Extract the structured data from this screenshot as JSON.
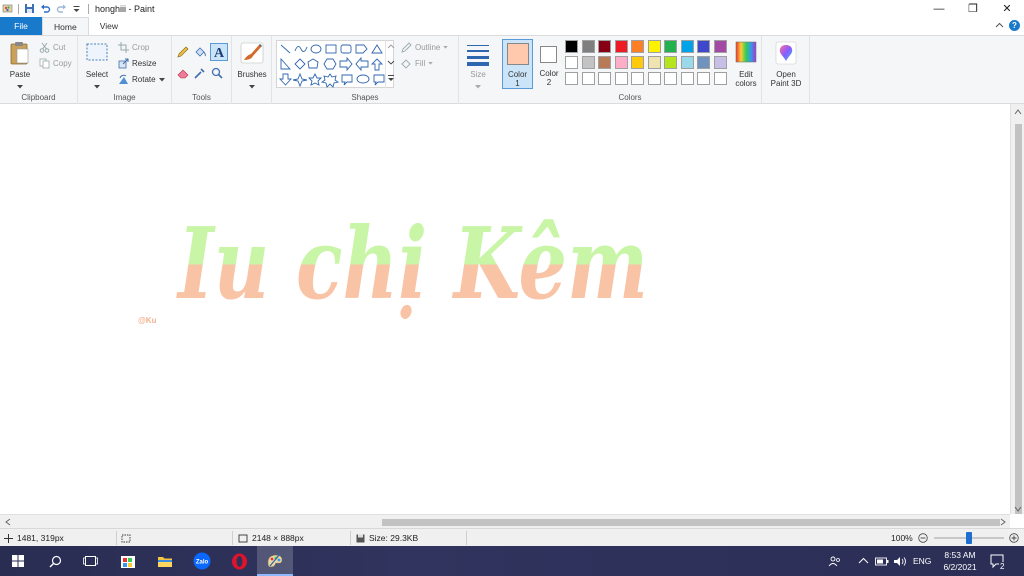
{
  "window": {
    "title": "honghiii - Paint",
    "minimize": "—",
    "restore": "❐",
    "close": "✕"
  },
  "tabs": [
    {
      "label": "File"
    },
    {
      "label": "Home"
    },
    {
      "label": "View"
    }
  ],
  "ribbon": {
    "clipboard": {
      "label": "Clipboard",
      "paste": "Paste",
      "cut": "Cut",
      "copy": "Copy"
    },
    "image": {
      "label": "Image",
      "select": "Select",
      "crop": "Crop",
      "resize": "Resize",
      "rotate": "Rotate"
    },
    "tools": {
      "label": "Tools"
    },
    "brushes": {
      "label": "Brushes"
    },
    "shapes": {
      "label": "Shapes",
      "outline": "Outline",
      "fill": "Fill"
    },
    "size": {
      "label": "Size"
    },
    "colors": {
      "label": "Colors",
      "color1": "Color 1",
      "color1_line1": "Color",
      "color1_line2": "1",
      "color2_line1": "Color",
      "color2_line2": "2",
      "color1_value": "#ffc9ae",
      "color2_value": "#ffffff",
      "edit_line1": "Edit",
      "edit_line2": "colors",
      "palette_row1": [
        "#000000",
        "#7f7f7f",
        "#880015",
        "#ed1c24",
        "#ff7f27",
        "#fff200",
        "#22b14c",
        "#00a2e8",
        "#3f48cc",
        "#a349a4"
      ],
      "palette_row2": [
        "#ffffff",
        "#c3c3c3",
        "#b97a57",
        "#ffaec9",
        "#ffc90e",
        "#efe4b0",
        "#b5e61d",
        "#99d9ea",
        "#7092be",
        "#c8bfe7"
      ],
      "palette_row3": [
        "#ffffff",
        "#ffffff",
        "#ffffff",
        "#ffffff",
        "#ffffff",
        "#ffffff",
        "#ffffff",
        "#ffffff",
        "#ffffff",
        "#ffffff"
      ]
    },
    "paint3d": {
      "line1": "Open",
      "line2": "Paint 3D"
    }
  },
  "canvas": {
    "text": "Iu chị Kêm",
    "watermark": "@Ku",
    "color_top": "#c9f5a6",
    "color_bottom": "#f9c3a6"
  },
  "status": {
    "cursor_pos": "1481, 319px",
    "image_size": "2148 × 888px",
    "file_size": "Size: 29.3KB",
    "zoom": "100%",
    "zoom_fraction": 0.5
  },
  "taskbar": {
    "lang": "ENG",
    "time": "8:53 AM",
    "date": "6/2/2021",
    "notifications": "2"
  }
}
